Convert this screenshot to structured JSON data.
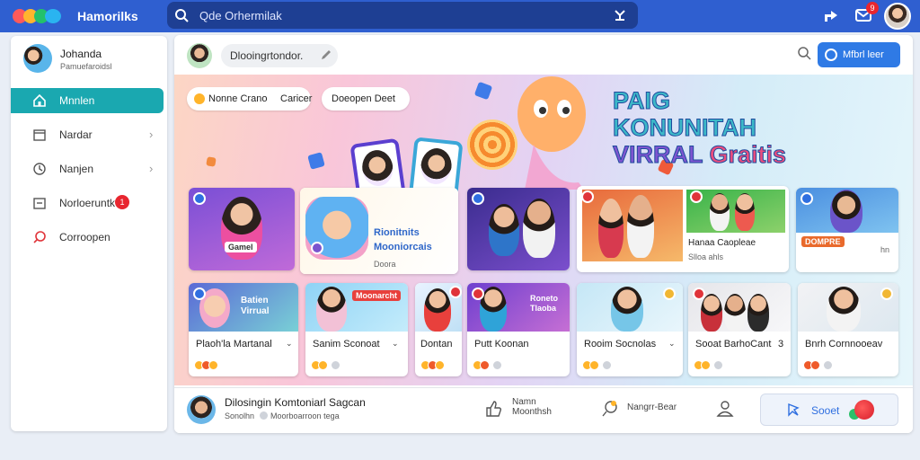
{
  "app": {
    "title": "Hamorilks"
  },
  "search": {
    "placeholder": "Qde Orhermilak"
  },
  "topbar": {
    "notif_count": "9"
  },
  "sidebar": {
    "profile": {
      "name": "Johanda",
      "subtitle": "Pamuefaroidsl"
    },
    "items": [
      {
        "label": "Mnnlen",
        "icon": "home-icon",
        "active": true
      },
      {
        "label": "Nardar",
        "icon": "calendar-icon",
        "chevron": true
      },
      {
        "label": "Nanjen",
        "icon": "clock-icon",
        "chevron": true
      },
      {
        "label": "Norloeruntk",
        "icon": "inbox-icon",
        "badge": "1"
      },
      {
        "label": "Corroopen",
        "icon": "search-icon"
      }
    ]
  },
  "main": {
    "composer_label": "Dlooingrtondor.",
    "header_button": "Mfbrl leer",
    "pills": [
      {
        "label": "Nonne Crano",
        "extra": "Caricer"
      },
      {
        "label": "Doeopen Deet"
      }
    ],
    "headline": {
      "line1": "PAIG KONUNITAH",
      "line2": "VIRRAL",
      "line3": "Graitis"
    },
    "feature_card": {
      "title": "Rionitnits",
      "title2": "Mooniorcais",
      "subtitle": "Doora"
    },
    "row1": [
      {
        "tag": "Gamel",
        "icon": "play-icon"
      },
      {
        "title": "",
        "icon": "play-icon"
      },
      {
        "title": "Hanaa Caopleae",
        "subtitle": "Slloa ahls",
        "icon": "play-icon"
      },
      {
        "tag": "DOMPRE",
        "extra": "hn",
        "icon": "play-icon"
      }
    ],
    "row2": [
      {
        "title": "Plaoh'la Martanal",
        "overlay": "Batien Virrual"
      },
      {
        "title": "Sanim Sconoat",
        "overlay": "Moonarcht"
      },
      {
        "title": "Dontan"
      },
      {
        "title": "Putt Koonan",
        "overlay": "Roneto Tlaoba"
      },
      {
        "title": "Rooim Socnolas"
      },
      {
        "title": "Sooat BarhoCant",
        "extra": "3"
      },
      {
        "title": "Bnrh Cornnooeav"
      }
    ]
  },
  "bottom": {
    "title": "Dilosingin Komtoniarl Sagcan",
    "subtitle_a": "Sonolhn",
    "subtitle_b": "Moorboarroon tega",
    "action1_a": "Namn",
    "action1_b": "Moonthsh",
    "action2": "Nangrr-Bear",
    "share_label": "Sooet"
  },
  "colors": {
    "topbar": "#2f5fd0",
    "accent": "#1aa8b0",
    "primary_button": "#2f7ae5",
    "badge": "#e8262f"
  }
}
